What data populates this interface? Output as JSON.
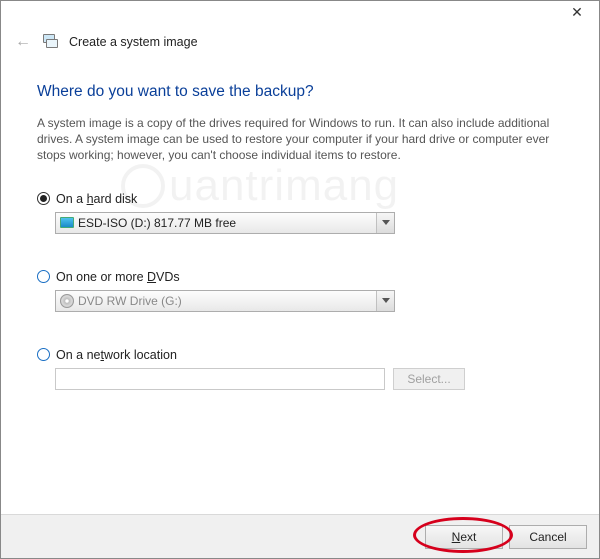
{
  "titlebar": {
    "close": "✕"
  },
  "header": {
    "back": "←",
    "title": "Create a system image"
  },
  "heading": "Where do you want to save the backup?",
  "description": "A system image is a copy of the drives required for Windows to run. It can also include additional drives. A system image can be used to restore your computer if your hard drive or computer ever stops working; however, you can't choose individual items to restore.",
  "options": {
    "hard_disk": {
      "label_pre": "On a ",
      "label_u": "h",
      "label_post": "ard disk",
      "selected": true,
      "value": "ESD-ISO (D:)  817.77 MB free"
    },
    "dvds": {
      "label_pre": "On one or more ",
      "label_u": "D",
      "label_post": "VDs",
      "selected": false,
      "value": "DVD RW Drive (G:)"
    },
    "network": {
      "label_pre": "On a ne",
      "label_u": "t",
      "label_post": "work location",
      "selected": false,
      "value": "",
      "select_btn": "Select..."
    }
  },
  "footer": {
    "next_u": "N",
    "next_post": "ext",
    "cancel": "Cancel"
  },
  "watermark": "uantrimang"
}
